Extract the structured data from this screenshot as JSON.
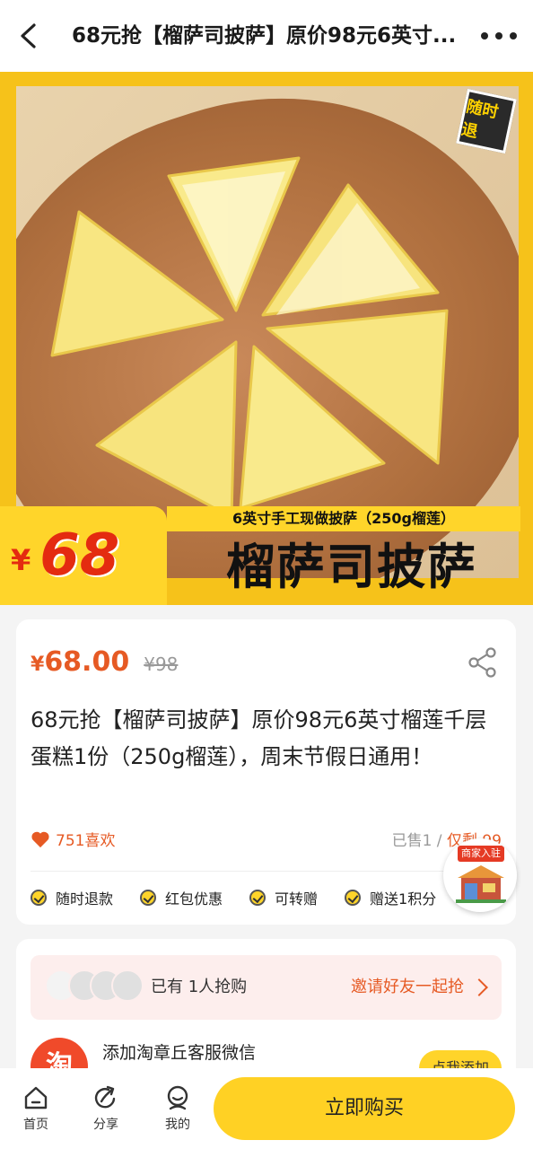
{
  "header": {
    "title": "68元抢【榴萨司披萨】原价98元6英寸..."
  },
  "hero": {
    "badge": "随时退",
    "currency_symbol": "¥",
    "price_big": "68",
    "subtitle": "6英寸手工现做披萨（250g榴莲）",
    "product_name": "榴萨司披萨"
  },
  "product": {
    "currency_symbol": "¥",
    "price": "68.00",
    "original_price": "¥98",
    "description": "68元抢【榴萨司披萨】原价98元6英寸榴莲千层蛋糕1份（250g榴莲），周末节假日通用！",
    "likes": "751喜欢",
    "sold": "已售1",
    "separator": " / ",
    "remaining": "仅剩 99",
    "tags": [
      "随时退款",
      "红包优惠",
      "可转赠",
      "赠送1积分"
    ]
  },
  "merchant": {
    "label": "商家入驻"
  },
  "group": {
    "joined_text": "已有 1人抢购",
    "invite_label": "邀请好友一起抢"
  },
  "wechat": {
    "logo_char": "淘",
    "text": "添加淘章丘客服微信",
    "button_label": "点我添加"
  },
  "bottom_bar": {
    "nav": [
      {
        "label": "首页",
        "icon": "home-icon"
      },
      {
        "label": "分享",
        "icon": "share-icon"
      },
      {
        "label": "我的",
        "icon": "profile-icon"
      }
    ],
    "buy_label": "立即购买"
  },
  "colors": {
    "accent_yellow": "#ffd124",
    "price_orange": "#e65a24",
    "hero_yellow": "#f6c21a"
  }
}
